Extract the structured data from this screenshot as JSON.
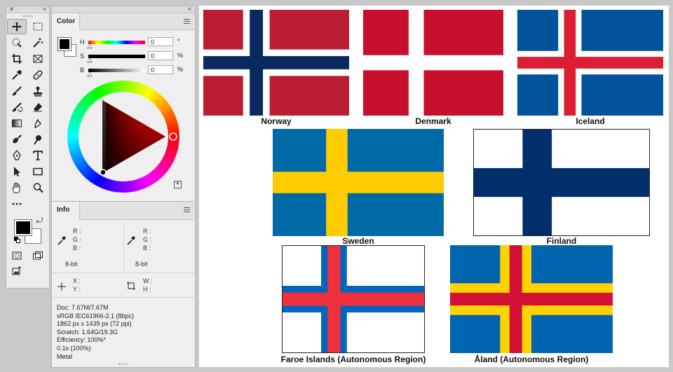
{
  "color_panel": {
    "tab_label": "Color",
    "h": {
      "label": "H",
      "value": "0",
      "unit": "°"
    },
    "s": {
      "label": "S",
      "value": "0",
      "unit": "%"
    },
    "b": {
      "label": "B",
      "value": "0",
      "unit": "%"
    }
  },
  "info_panel": {
    "tab_label": "Info",
    "left_rgb": [
      "R :",
      "G :",
      "B :"
    ],
    "right_rgb": [
      "R :",
      "G :",
      "B :"
    ],
    "left_depth": "8-bit",
    "right_depth": "8-bit",
    "xy": [
      "X :",
      "Y :"
    ],
    "wh": [
      "W :",
      "H :"
    ],
    "doc_lines": [
      "Doc: 7.67M/7.67M",
      "sRGB IEC61966-2.1 (8bpc)",
      "1862 px x 1439 px (72 ppi)",
      "Scratch: 1.64G/19.3G",
      "Efficiency: 100%*",
      "0.1s (100%)",
      "Metal"
    ]
  },
  "canvas": {
    "flags": [
      {
        "name": "Norway",
        "field": "#bd1d33",
        "outer": "#ffffff",
        "inner": "#082a5e"
      },
      {
        "name": "Denmark",
        "field": "#c8102e",
        "outer": "#ffffff"
      },
      {
        "name": "Iceland",
        "field": "#02529c",
        "outer": "#ffffff",
        "inner": "#dc1e35"
      },
      {
        "name": "Sweden",
        "field": "#006aa7",
        "outer": "#fecc00"
      },
      {
        "name": "Finland",
        "field": "#ffffff",
        "outer": "#002f6c"
      },
      {
        "name": "Faroe Islands (Autonomous Region)",
        "field": "#ffffff",
        "outer": "#0065bd",
        "inner": "#ef303e"
      },
      {
        "name": "Åland (Autonomous Region)",
        "field": "#0064ae",
        "outer": "#ffd300",
        "inner": "#d21034"
      }
    ]
  }
}
